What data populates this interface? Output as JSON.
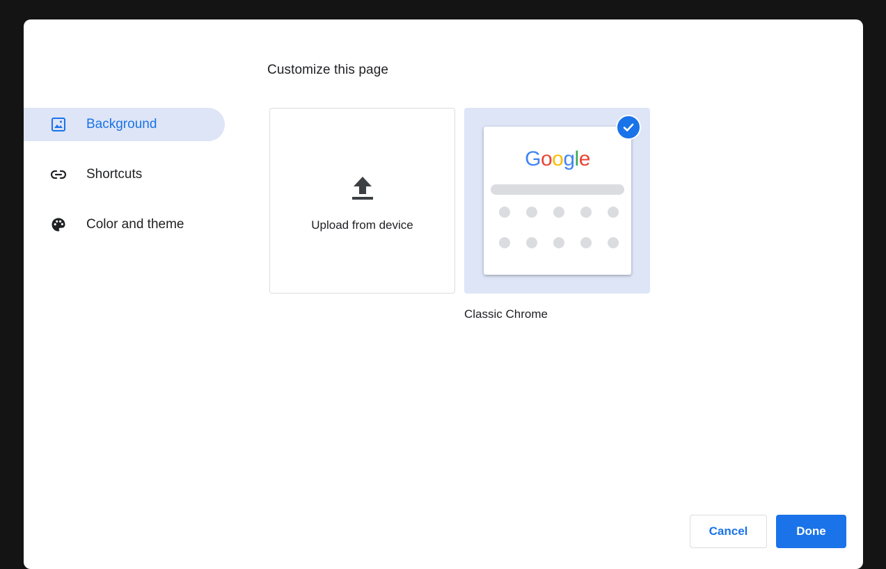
{
  "dialog": {
    "title": "Customize this page"
  },
  "sidebar": {
    "items": [
      {
        "label": "Background",
        "icon": "image-icon",
        "selected": true
      },
      {
        "label": "Shortcuts",
        "icon": "link-icon",
        "selected": false
      },
      {
        "label": "Color and theme",
        "icon": "palette-icon",
        "selected": false
      }
    ]
  },
  "tiles": {
    "upload": {
      "label": "Upload from device",
      "icon": "upload-icon"
    },
    "classic": {
      "caption": "Classic Chrome",
      "selected": true,
      "preview": {
        "logo_letters": [
          "G",
          "o",
          "o",
          "g",
          "l",
          "e"
        ],
        "logo_colors": [
          "#4285f4",
          "#ea4335",
          "#fbbc05",
          "#4285f4",
          "#34a853",
          "#ea4335"
        ]
      }
    }
  },
  "footer": {
    "cancel_label": "Cancel",
    "done_label": "Done"
  },
  "colors": {
    "accent": "#1a73e8",
    "selected_bg": "#dde5f7",
    "backdrop": "#141414"
  }
}
